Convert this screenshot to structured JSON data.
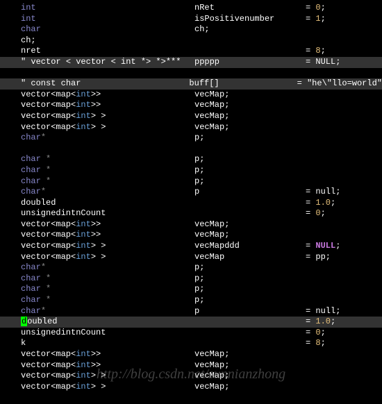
{
  "lines": [
    {
      "c1": [
        {
          "t": "int",
          "c": "kw"
        }
      ],
      "c2": [
        {
          "t": "nRet",
          "c": "id"
        }
      ],
      "c3": [
        {
          "t": "= ",
          "c": "id"
        },
        {
          "t": "0",
          "c": "num"
        },
        {
          "t": ";",
          "c": "id"
        }
      ]
    },
    {
      "c1": [
        {
          "t": "int",
          "c": "kw"
        }
      ],
      "c2": [
        {
          "t": "isPositivenumber",
          "c": "id"
        }
      ],
      "c3": [
        {
          "t": "= ",
          "c": "id"
        },
        {
          "t": "1",
          "c": "num"
        },
        {
          "t": ";",
          "c": "id"
        }
      ]
    },
    {
      "c1": [
        {
          "t": "char",
          "c": "kw"
        }
      ],
      "c2": [
        {
          "t": "ch;",
          "c": "id"
        }
      ],
      "c3": []
    },
    {
      "c1": [
        {
          "t": "ch;",
          "c": "id"
        }
      ],
      "c2": [],
      "c3": []
    },
    {
      "c1": [
        {
          "t": "nret",
          "c": "id"
        }
      ],
      "c2": [],
      "c3": [
        {
          "t": "= ",
          "c": "id"
        },
        {
          "t": "8",
          "c": "num"
        },
        {
          "t": ";",
          "c": "id"
        }
      ]
    },
    {
      "hl": true,
      "c1": [
        {
          "t": "\"",
          "c": "id"
        },
        {
          "t": " vector < vector < int *> *>***",
          "c": "id"
        }
      ],
      "c2": [
        {
          "t": "ppppp",
          "c": "id"
        }
      ],
      "c3": [
        {
          "t": "= NULL;",
          "c": "id"
        }
      ]
    },
    {
      "blank": true
    },
    {
      "hl": true,
      "c1": [
        {
          "t": "\"",
          "c": "id"
        },
        {
          "t": " const char",
          "c": "id"
        }
      ],
      "c2": [
        {
          "t": "buff[]",
          "c": "id"
        }
      ],
      "c3": [
        {
          "t": "= ",
          "c": "id"
        },
        {
          "t": "\"he\\\"llo=world\"",
          "c": "id"
        }
      ]
    },
    {
      "c1": [
        {
          "t": "vector<map<",
          "c": "id"
        },
        {
          "t": "int",
          "c": "tpl"
        },
        {
          "t": ">>",
          "c": "id"
        }
      ],
      "c2": [
        {
          "t": "vecMap;",
          "c": "id"
        }
      ],
      "c3": []
    },
    {
      "c1": [
        {
          "t": "vector<map<",
          "c": "id"
        },
        {
          "t": "int",
          "c": "tpl"
        },
        {
          "t": ">>",
          "c": "id"
        }
      ],
      "c2": [
        {
          "t": "vecMap;",
          "c": "id"
        }
      ],
      "c3": []
    },
    {
      "c1": [
        {
          "t": "vector<map<",
          "c": "id"
        },
        {
          "t": "int",
          "c": "tpl"
        },
        {
          "t": "> >",
          "c": "id"
        }
      ],
      "c2": [
        {
          "t": "vecMap;",
          "c": "id"
        }
      ],
      "c3": []
    },
    {
      "c1": [
        {
          "t": "vector<map<",
          "c": "id"
        },
        {
          "t": "int",
          "c": "tpl"
        },
        {
          "t": "> >",
          "c": "id"
        }
      ],
      "c2": [
        {
          "t": "vecMap;",
          "c": "id"
        }
      ],
      "c3": []
    },
    {
      "c1": [
        {
          "t": "char",
          "c": "kw"
        },
        {
          "t": "*",
          "c": "op"
        }
      ],
      "c2": [
        {
          "t": "p;",
          "c": "id"
        }
      ],
      "c3": []
    },
    {
      "blank": true
    },
    {
      "c1": [
        {
          "t": "char",
          "c": "kw"
        },
        {
          "t": " ",
          "c": "id"
        },
        {
          "t": "*",
          "c": "op"
        }
      ],
      "c2": [
        {
          "t": "p;",
          "c": "id"
        }
      ],
      "c3": []
    },
    {
      "c1": [
        {
          "t": "char",
          "c": "kw"
        },
        {
          "t": " ",
          "c": "id"
        },
        {
          "t": "*",
          "c": "op"
        }
      ],
      "c2": [
        {
          "t": "p;",
          "c": "id"
        }
      ],
      "c3": []
    },
    {
      "c1": [
        {
          "t": "char",
          "c": "kw"
        },
        {
          "t": " ",
          "c": "id"
        },
        {
          "t": "*",
          "c": "op"
        }
      ],
      "c2": [
        {
          "t": "p;",
          "c": "id"
        }
      ],
      "c3": []
    },
    {
      "c1": [
        {
          "t": "char",
          "c": "kw"
        },
        {
          "t": "*",
          "c": "op"
        }
      ],
      "c2": [
        {
          "t": "p",
          "c": "id"
        }
      ],
      "c3": [
        {
          "t": "= null;",
          "c": "id"
        }
      ]
    },
    {
      "c1": [
        {
          "t": "doubled",
          "c": "id"
        }
      ],
      "c2": [],
      "c3": [
        {
          "t": "= ",
          "c": "id"
        },
        {
          "t": "1.0",
          "c": "num"
        },
        {
          "t": ";",
          "c": "id"
        }
      ]
    },
    {
      "c1": [
        {
          "t": "unsignedintnCount",
          "c": "id"
        }
      ],
      "c2": [],
      "c3": [
        {
          "t": "= ",
          "c": "id"
        },
        {
          "t": "0",
          "c": "num"
        },
        {
          "t": ";",
          "c": "id"
        }
      ]
    },
    {
      "c1": [
        {
          "t": "vector<map<",
          "c": "id"
        },
        {
          "t": "int",
          "c": "tpl"
        },
        {
          "t": ">>",
          "c": "id"
        }
      ],
      "c2": [
        {
          "t": "vecMap;",
          "c": "id"
        }
      ],
      "c3": []
    },
    {
      "c1": [
        {
          "t": "vector<map<",
          "c": "id"
        },
        {
          "t": "int",
          "c": "tpl"
        },
        {
          "t": ">>",
          "c": "id"
        }
      ],
      "c2": [
        {
          "t": "vecMap;",
          "c": "id"
        }
      ],
      "c3": []
    },
    {
      "c1": [
        {
          "t": "vector<map<",
          "c": "id"
        },
        {
          "t": "int",
          "c": "tpl"
        },
        {
          "t": "> >",
          "c": "id"
        }
      ],
      "c2": [
        {
          "t": "vecMapddd",
          "c": "id"
        }
      ],
      "c3": [
        {
          "t": "= ",
          "c": "id"
        },
        {
          "t": "NULL",
          "c": "null bold"
        },
        {
          "t": ";",
          "c": "id"
        }
      ]
    },
    {
      "c1": [
        {
          "t": "vector<map<",
          "c": "id"
        },
        {
          "t": "int",
          "c": "tpl"
        },
        {
          "t": "> >",
          "c": "id"
        }
      ],
      "c2": [
        {
          "t": "vecMap",
          "c": "id"
        }
      ],
      "c3": [
        {
          "t": "= pp;",
          "c": "id"
        }
      ]
    },
    {
      "c1": [
        {
          "t": "char",
          "c": "kw"
        },
        {
          "t": "*",
          "c": "op"
        }
      ],
      "c2": [
        {
          "t": "p;",
          "c": "id"
        }
      ],
      "c3": []
    },
    {
      "c1": [
        {
          "t": "char",
          "c": "kw"
        },
        {
          "t": " ",
          "c": "id"
        },
        {
          "t": "*",
          "c": "op"
        }
      ],
      "c2": [
        {
          "t": "p;",
          "c": "id"
        }
      ],
      "c3": []
    },
    {
      "c1": [
        {
          "t": "char",
          "c": "kw"
        },
        {
          "t": " ",
          "c": "id"
        },
        {
          "t": "*",
          "c": "op"
        }
      ],
      "c2": [
        {
          "t": "p;",
          "c": "id"
        }
      ],
      "c3": []
    },
    {
      "c1": [
        {
          "t": "char",
          "c": "kw"
        },
        {
          "t": " ",
          "c": "id"
        },
        {
          "t": "*",
          "c": "op"
        }
      ],
      "c2": [
        {
          "t": "p;",
          "c": "id"
        }
      ],
      "c3": []
    },
    {
      "c1": [
        {
          "t": "char",
          "c": "kw"
        },
        {
          "t": "*",
          "c": "op"
        }
      ],
      "c2": [
        {
          "t": "p",
          "c": "id"
        }
      ],
      "c3": [
        {
          "t": "= null;",
          "c": "id"
        }
      ]
    },
    {
      "hl": true,
      "cursor": true,
      "c1": [
        {
          "t": "oubled",
          "c": "id"
        }
      ],
      "c2": [],
      "c3": [
        {
          "t": "= ",
          "c": "id"
        },
        {
          "t": "1.0",
          "c": "num"
        },
        {
          "t": ";",
          "c": "id"
        }
      ]
    },
    {
      "c1": [
        {
          "t": "unsignedintnCount",
          "c": "id"
        }
      ],
      "c2": [],
      "c3": [
        {
          "t": "= ",
          "c": "id"
        },
        {
          "t": "0",
          "c": "num"
        },
        {
          "t": ";",
          "c": "id"
        }
      ]
    },
    {
      "c1": [
        {
          "t": "k",
          "c": "id"
        }
      ],
      "c2": [],
      "c3": [
        {
          "t": "= ",
          "c": "id"
        },
        {
          "t": "8",
          "c": "num"
        },
        {
          "t": ";",
          "c": "id"
        }
      ]
    },
    {
      "c1": [
        {
          "t": "vector<map<",
          "c": "id"
        },
        {
          "t": "int",
          "c": "tpl"
        },
        {
          "t": ">>",
          "c": "id"
        }
      ],
      "c2": [
        {
          "t": "vecMap;",
          "c": "id"
        }
      ],
      "c3": []
    },
    {
      "c1": [
        {
          "t": "vector<map<",
          "c": "id"
        },
        {
          "t": "int",
          "c": "tpl"
        },
        {
          "t": ">>",
          "c": "id"
        }
      ],
      "c2": [
        {
          "t": "vecMap;",
          "c": "id"
        }
      ],
      "c3": []
    },
    {
      "c1": [
        {
          "t": "vector<map<",
          "c": "id"
        },
        {
          "t": "int",
          "c": "tpl"
        },
        {
          "t": "> >",
          "c": "id"
        }
      ],
      "c2": [
        {
          "t": "vecMap;",
          "c": "id"
        }
      ],
      "c3": []
    },
    {
      "c1": [
        {
          "t": "vector<map<",
          "c": "id"
        },
        {
          "t": "int",
          "c": "tpl"
        },
        {
          "t": "> >",
          "c": "id"
        }
      ],
      "c2": [
        {
          "t": "vecMap;",
          "c": "id"
        }
      ],
      "c3": []
    }
  ],
  "watermark": "http://blog.csdn.net/sunnianzhong",
  "cursor_char": "d"
}
